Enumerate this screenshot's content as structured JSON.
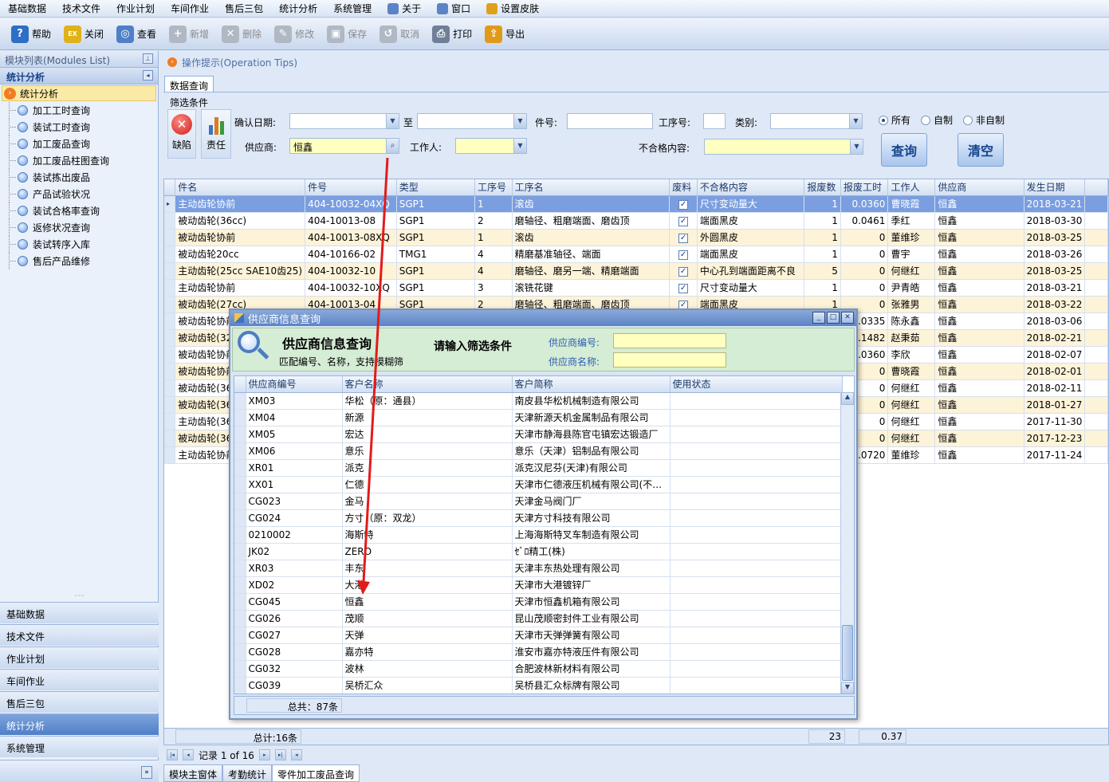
{
  "menubar": {
    "items": [
      "基础数据",
      "技术文件",
      "作业计划",
      "车间作业",
      "售后三包",
      "统计分析",
      "系统管理"
    ],
    "icon_items": [
      "关于",
      "窗口",
      "设置皮肤"
    ]
  },
  "toolbar": {
    "buttons": [
      {
        "label": "帮助",
        "icon": "help-icon",
        "color": "#2d6ec6",
        "enabled": true
      },
      {
        "label": "关闭",
        "icon": "exit-icon",
        "color": "#e0b21a",
        "enabled": true
      },
      {
        "label": "查看",
        "icon": "view-icon",
        "color": "#4f7fc7",
        "enabled": true
      },
      {
        "label": "新增",
        "icon": "new-icon",
        "color": "#b0b8c4",
        "enabled": false
      },
      {
        "label": "删除",
        "icon": "delete-icon",
        "color": "#b0b8c4",
        "enabled": false
      },
      {
        "label": "修改",
        "icon": "edit-icon",
        "color": "#b0b8c4",
        "enabled": false
      },
      {
        "label": "保存",
        "icon": "save-icon",
        "color": "#b0b8c4",
        "enabled": false
      },
      {
        "label": "取消",
        "icon": "cancel-icon",
        "color": "#b0b8c4",
        "enabled": false
      },
      {
        "label": "打印",
        "icon": "print-icon",
        "color": "#6f7f96",
        "enabled": true
      },
      {
        "label": "导出",
        "icon": "export-icon",
        "color": "#e09a1a",
        "enabled": true
      }
    ]
  },
  "sidebar": {
    "header": "模块列表(Modules List)",
    "section": "统计分析",
    "root": "统计分析",
    "items": [
      "加工工时查询",
      "装试工时查询",
      "加工废品查询",
      "加工废品柱图查询",
      "装试拣出废品",
      "产品试验状况",
      "装试合格率查询",
      "返修状况查询",
      "装试转序入库",
      "售后产品维修"
    ],
    "nav": [
      "基础数据",
      "技术文件",
      "作业计划",
      "车间作业",
      "售后三包",
      "统计分析",
      "系统管理"
    ],
    "nav_selected": "统计分析"
  },
  "tips": "操作提示(Operation Tips)",
  "tab": "数据查询",
  "filter": {
    "group": "筛选条件",
    "btn_defect": "缺陷",
    "btn_duty": "责任",
    "date_label": "确认日期:",
    "to_label": "至",
    "part_label": "件号:",
    "proc_label": "工序号:",
    "type_label": "类别:",
    "supplier_label": "供应商:",
    "supplier_value": "恒鑫",
    "worker_label": "工作人:",
    "defect_label": "不合格内容:",
    "query_btn": "查询",
    "clear_btn": "清空",
    "radios": [
      "所有",
      "自制",
      "非自制"
    ],
    "radio_selected": "所有"
  },
  "grid": {
    "columns": [
      "件名",
      "件号",
      "类型",
      "工序号",
      "工序名",
      "废料",
      "不合格内容",
      "报废数",
      "报废工时",
      "工作人",
      "供应商",
      "发生日期"
    ],
    "rows": [
      [
        "主动齿轮协前",
        "404-10032-04XQ",
        "SGP1",
        "1",
        "滚齿",
        true,
        "尺寸变动量大",
        "1",
        "0.0360",
        "曹晓霞",
        "恒鑫",
        "2018-03-21"
      ],
      [
        "被动齿轮(36cc)",
        "404-10013-08",
        "SGP1",
        "2",
        "磨轴径、粗磨端面、磨齿顶",
        true,
        "端面黑皮",
        "1",
        "0.0461",
        "季红",
        "恒鑫",
        "2018-03-30"
      ],
      [
        "被动齿轮协前",
        "404-10013-08XQ",
        "SGP1",
        "1",
        "滚齿",
        true,
        "外圆黑皮",
        "1",
        "0",
        "董维珍",
        "恒鑫",
        "2018-03-25"
      ],
      [
        "被动齿轮20cc",
        "404-10166-02",
        "TMG1",
        "4",
        "精磨基准轴径、端面",
        true,
        "端面黑皮",
        "1",
        "0",
        "曹宇",
        "恒鑫",
        "2018-03-26"
      ],
      [
        "主动齿轮(25cc SAE10齿25)",
        "404-10032-10",
        "SGP1",
        "4",
        "磨轴径、磨另一端、精磨端面",
        true,
        "中心孔到端面距离不良",
        "5",
        "0",
        "何继红",
        "恒鑫",
        "2018-03-25"
      ],
      [
        "主动齿轮协前",
        "404-10032-10XQ",
        "SGP1",
        "3",
        "滚铣花键",
        true,
        "尺寸变动量大",
        "1",
        "0",
        "尹青皓",
        "恒鑫",
        "2018-03-21"
      ],
      [
        "被动齿轮(27cc)",
        "404-10013-04",
        "SGP1",
        "2",
        "磨轴径、粗磨端面、磨齿顶",
        true,
        "端面黑皮",
        "1",
        "0",
        "张雅男",
        "恒鑫",
        "2018-03-22"
      ],
      [
        "被动齿轮协前",
        "",
        "",
        "",
        "",
        false,
        "",
        "",
        "0.0335",
        "陈永鑫",
        "恒鑫",
        "2018-03-06"
      ],
      [
        "被动齿轮(32",
        "",
        "",
        "",
        "",
        false,
        "",
        "",
        "0.1482",
        "赵秉茹",
        "恒鑫",
        "2018-02-21"
      ],
      [
        "被动齿轮协前",
        "",
        "",
        "",
        "",
        false,
        "",
        "",
        "0.0360",
        "李欣",
        "恒鑫",
        "2018-02-07"
      ],
      [
        "被动齿轮协前",
        "",
        "",
        "",
        "",
        false,
        "",
        "",
        "0",
        "曹晓霞",
        "恒鑫",
        "2018-02-01"
      ],
      [
        "被动齿轮(36",
        "",
        "",
        "",
        "",
        false,
        "",
        "",
        "0",
        "何继红",
        "恒鑫",
        "2018-02-11"
      ],
      [
        "被动齿轮(36",
        "",
        "",
        "",
        "",
        false,
        "",
        "",
        "0",
        "何继红",
        "恒鑫",
        "2018-01-27"
      ],
      [
        "主动齿轮(36",
        "",
        "",
        "",
        "",
        false,
        "",
        "",
        "0",
        "何继红",
        "恒鑫",
        "2017-11-30"
      ],
      [
        "被动齿轮(36",
        "",
        "",
        "",
        "",
        false,
        "",
        "",
        "0",
        "何继红",
        "恒鑫",
        "2017-12-23"
      ],
      [
        "主动齿轮协前",
        "",
        "",
        "",
        "",
        false,
        "",
        "",
        "0.0720",
        "董维珍",
        "恒鑫",
        "2017-11-24"
      ]
    ],
    "total": "总计:16条",
    "sum_count": "23",
    "sum_hours": "0.37"
  },
  "pager": {
    "text": "记录 1 of 16"
  },
  "bottom_tabs": [
    "模块主窗体",
    "考勤统计",
    "零件加工废品查询"
  ],
  "bottom_tab_selected": "零件加工废品查询",
  "dialog": {
    "title": "供应商信息查询",
    "heading": "供应商信息查询",
    "subheading": "匹配编号、名称，支持模糊筛",
    "prompt": "请输入筛选条件",
    "code_label": "供应商编号:",
    "name_label": "供应商名称:",
    "columns": [
      "供应商编号",
      "客户名称",
      "客户简称",
      "使用状态"
    ],
    "rows": [
      [
        "XM03",
        "华松（原：通县）",
        "南皮县华松机械制造有限公司",
        ""
      ],
      [
        "XM04",
        "新源",
        "天津新源天机金属制品有限公司",
        ""
      ],
      [
        "XM05",
        "宏达",
        "天津市静海县陈官屯镇宏达锻造厂",
        ""
      ],
      [
        "XM06",
        "意乐",
        "意乐（天津）铝制品有限公司",
        ""
      ],
      [
        "XR01",
        "派克",
        "派克汉尼芬(天津)有限公司",
        ""
      ],
      [
        "XX01",
        "仁德",
        "天津市仁德液压机械有限公司(不…",
        ""
      ],
      [
        "CG023",
        "金马",
        "天津金马阀门厂",
        ""
      ],
      [
        "CG024",
        "方寸（原：双龙）",
        "天津方寸科技有限公司",
        ""
      ],
      [
        "0210002",
        "海斯特",
        "上海海斯特叉车制造有限公司",
        ""
      ],
      [
        "JK02",
        "ZERO",
        "ｾﾞﾛ精工(株)",
        ""
      ],
      [
        "XR03",
        "丰东",
        "天津丰东热处理有限公司",
        ""
      ],
      [
        "XD02",
        "大港",
        "天津市大港镀锌厂",
        ""
      ],
      [
        "CG045",
        "恒鑫",
        "天津市恒鑫机箱有限公司",
        ""
      ],
      [
        "CG026",
        "茂顺",
        "昆山茂顺密封件工业有限公司",
        ""
      ],
      [
        "CG027",
        "天弹",
        "天津市天弹弹簧有限公司",
        ""
      ],
      [
        "CG028",
        "嘉亦特",
        "淮安市嘉亦特液压件有限公司",
        ""
      ],
      [
        "CG032",
        "波林",
        "合肥波林新材料有限公司",
        ""
      ],
      [
        "CG039",
        "吴桥汇众",
        "吴桥县汇众标牌有限公司",
        ""
      ]
    ],
    "total": "总共：87条"
  }
}
